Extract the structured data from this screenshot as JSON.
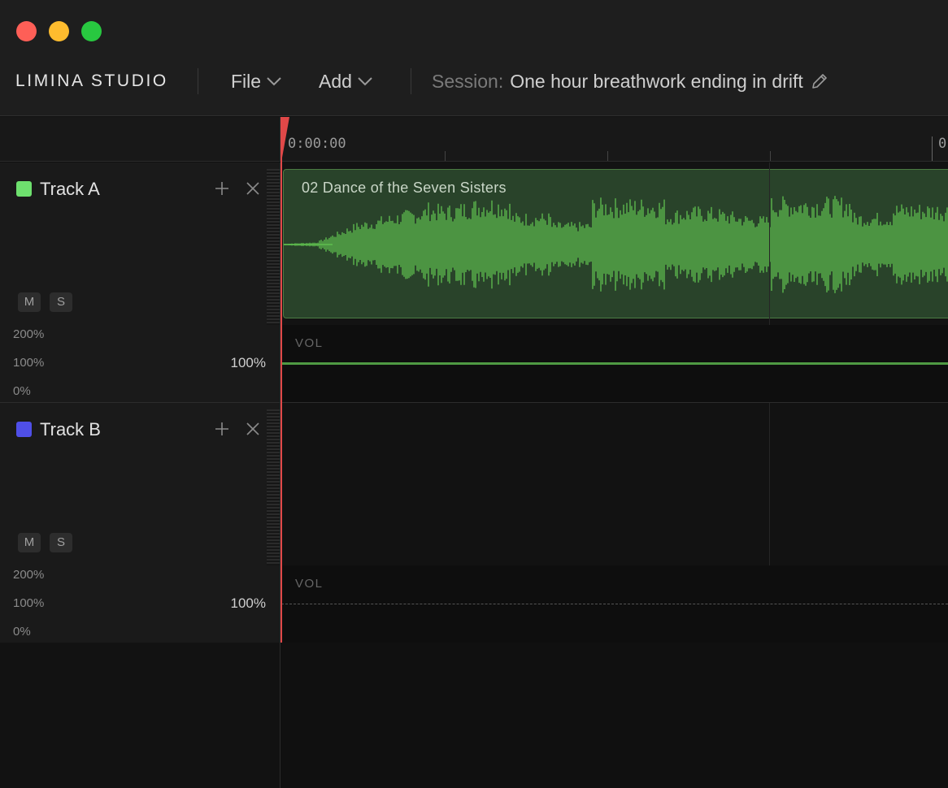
{
  "app": {
    "brand": "LIMINA STUDIO",
    "menus": [
      {
        "label": "File"
      },
      {
        "label": "Add"
      }
    ],
    "session": {
      "label": "Session:",
      "name": "One hour breathwork ending in drift"
    }
  },
  "ruler": {
    "start_label": "0:00:00",
    "next_label": "0"
  },
  "tracks": [
    {
      "name": "Track A",
      "color": "#6ee06e",
      "mute_label": "M",
      "solo_label": "S",
      "scale": [
        "200%",
        "100%",
        "0%"
      ],
      "volume": "100%",
      "vol_lane_label": "VOL",
      "clip": {
        "name": "02 Dance of the Seven Sisters",
        "color": "#5fbf4f"
      }
    },
    {
      "name": "Track B",
      "color": "#4f4fe8",
      "mute_label": "M",
      "solo_label": "S",
      "scale": [
        "200%",
        "100%",
        "0%"
      ],
      "volume": "100%",
      "vol_lane_label": "VOL"
    }
  ],
  "colors": {
    "playhead": "#e04848",
    "background": "#111111",
    "accent_green": "#5fbf4f"
  }
}
